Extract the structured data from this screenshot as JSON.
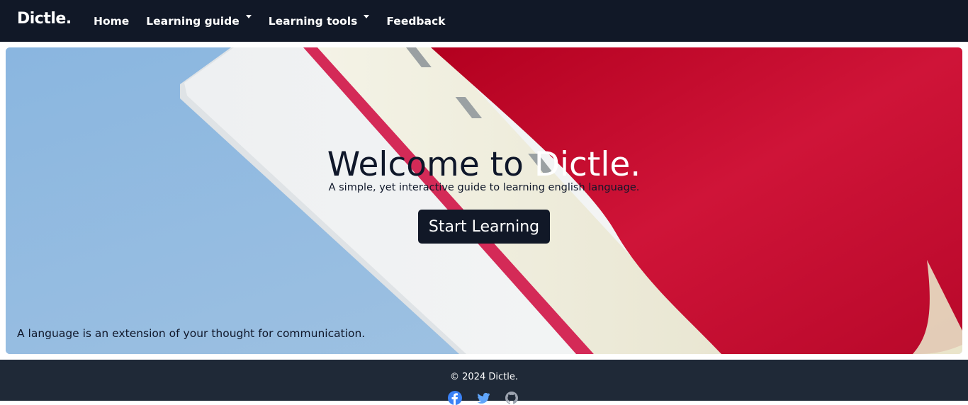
{
  "navbar": {
    "brand": "Dictle.",
    "items": [
      {
        "label": "Home"
      },
      {
        "label": "Learning guide"
      },
      {
        "label": "Learning tools"
      },
      {
        "label": "Feedback"
      }
    ]
  },
  "hero": {
    "title_part1": "Welcome to ",
    "title_part2": "Dictle.",
    "subtitle": "A simple, yet interactive guide to learning english language.",
    "cta_label": "Start Learning",
    "quote": "A language is an extension of your thought for communication."
  },
  "footer": {
    "copyright": "© 2024 Dictle.",
    "socials": [
      "facebook-icon",
      "twitter-icon",
      "github-icon"
    ]
  },
  "colors": {
    "navbar_bg": "#111827",
    "footer_bg": "#1f2937",
    "hero_blue": "#93badf",
    "book_red": "#c8102e",
    "facebook_blue": "#3b82f6"
  }
}
